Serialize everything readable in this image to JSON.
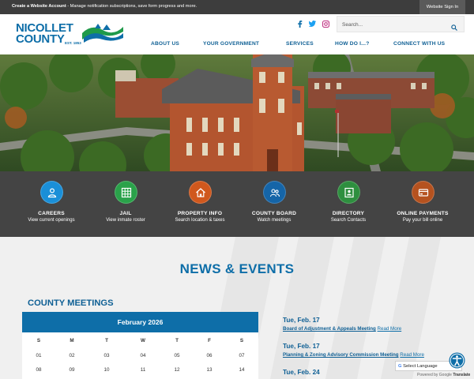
{
  "topbar": {
    "create_account_link": "Create a Website Account",
    "create_account_desc": " - Manage notification subscriptions, save form progress and more.",
    "sign_in_label": "Website Sign In"
  },
  "logo": {
    "line1": "NICOLLET",
    "line2": "COUNTY",
    "est": "EST. 1853"
  },
  "social": [
    "facebook-icon",
    "twitter-icon",
    "instagram-icon"
  ],
  "search": {
    "placeholder": "Search..."
  },
  "nav": {
    "items": [
      {
        "label": "ABOUT US"
      },
      {
        "label": "YOUR GOVERNMENT"
      },
      {
        "label": "SERVICES"
      },
      {
        "label": "HOW DO I...?"
      },
      {
        "label": "CONNECT WITH US"
      }
    ]
  },
  "quick_links": [
    {
      "title": "CAREERS",
      "subtitle": "View current openings",
      "color": "#1a8fd8",
      "icon": "person-icon"
    },
    {
      "title": "JAIL",
      "subtitle": "View inmate roster",
      "color": "#2aa24a",
      "icon": "grid-icon"
    },
    {
      "title": "PROPERTY INFO",
      "subtitle": "Search location & taxes",
      "color": "#d0581d",
      "icon": "home-icon"
    },
    {
      "title": "COUNTY BOARD",
      "subtitle": "Watch meetings",
      "color": "#1565a8",
      "icon": "people-icon"
    },
    {
      "title": "DIRECTORY",
      "subtitle": "Search Contacts",
      "color": "#2e8f3f",
      "icon": "contact-card-icon"
    },
    {
      "title": "ONLINE PAYMENTS",
      "subtitle": "Pay your bill online",
      "color": "#b5521f",
      "icon": "payment-card-icon"
    }
  ],
  "news": {
    "title": "NEWS & EVENTS",
    "meetings_title": "COUNTY MEETINGS",
    "calendar": {
      "month": "February 2026",
      "weekdays": [
        "S",
        "M",
        "T",
        "W",
        "T",
        "F",
        "S"
      ],
      "rows": [
        [
          "01",
          "02",
          "03",
          "04",
          "05",
          "06",
          "07"
        ],
        [
          "08",
          "09",
          "10",
          "11",
          "12",
          "13",
          "14"
        ]
      ]
    },
    "events": [
      {
        "date": "Tue, Feb. 17",
        "name": "Board of Adjustment & Appeals Meeting",
        "more": "Read More"
      },
      {
        "date": "Tue, Feb. 17",
        "name": "Planning & Zoning Advisory Commission Meeting",
        "more": "Read More"
      },
      {
        "date": "Tue, Feb. 24",
        "name": "",
        "more": ""
      }
    ]
  },
  "translate": {
    "label": "Select Language",
    "powered_prefix": "Powered by",
    "google": "Google",
    "translate": "Translate"
  },
  "colors": {
    "brand_blue": "#0e6ea8",
    "dark_bar": "#444444",
    "topbar": "#3d3d3d"
  }
}
